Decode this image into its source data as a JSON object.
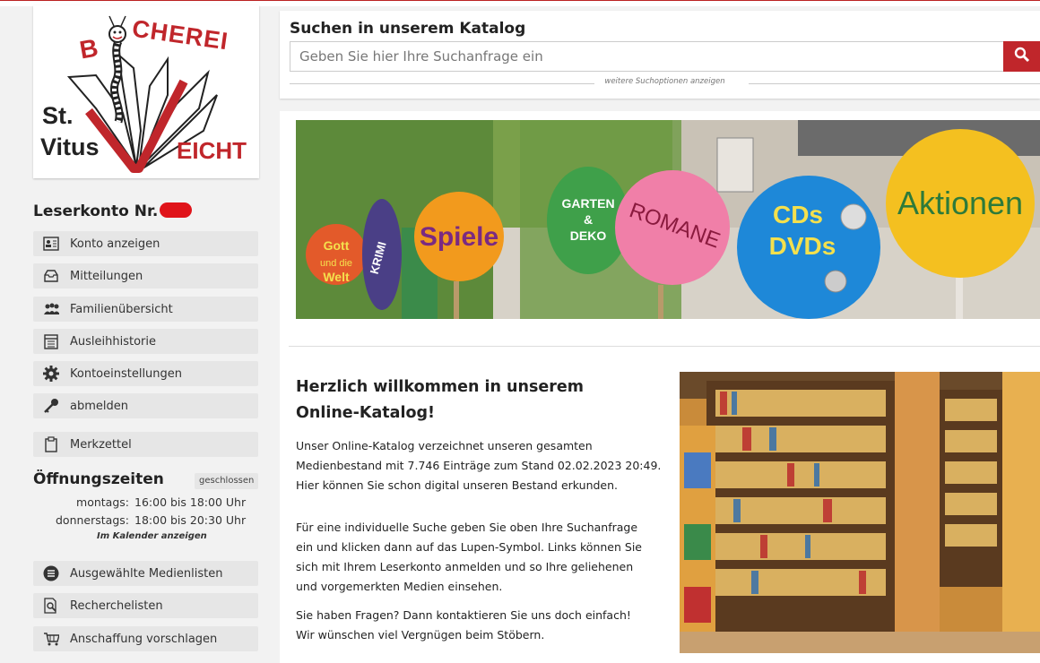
{
  "logo": {
    "text_top": "CHEREI",
    "text_b": "B",
    "text_st": "St.",
    "text_vitus": "Vitus",
    "text_eicht": "EICHT"
  },
  "account": {
    "title": "Leserkonto Nr.",
    "menu": [
      {
        "label": "Konto anzeigen",
        "icon": "id-card-icon"
      },
      {
        "label": "Mitteilungen",
        "icon": "inbox-icon"
      },
      {
        "label": "Familienübersicht",
        "icon": "family-icon"
      },
      {
        "label": "Ausleihhistorie",
        "icon": "calendar-list-icon"
      },
      {
        "label": "Kontoeinstellungen",
        "icon": "gear-icon"
      },
      {
        "label": "abmelden",
        "icon": "key-icon"
      }
    ],
    "notepad": {
      "label": "Merkzettel",
      "icon": "clipboard-icon"
    }
  },
  "hours": {
    "title": "Öffnungszeiten",
    "status": "geschlossen",
    "rows": [
      {
        "day": "montags:",
        "time": "16:00 bis 18:00 Uhr"
      },
      {
        "day": "donnerstags:",
        "time": "18:00 bis 20:30 Uhr"
      }
    ],
    "calendar_link": "Im Kalender anzeigen"
  },
  "lists": [
    {
      "label": "Ausgewählte Medienlisten",
      "icon": "list-circle-icon"
    },
    {
      "label": "Recherchelisten",
      "icon": "search-document-icon"
    },
    {
      "label": "Anschaffung vorschlagen",
      "icon": "cart-icon"
    }
  ],
  "search": {
    "title": "Suchen in unserem Katalog",
    "placeholder": "Geben Sie hier Ihre Suchanfrage ein",
    "more_options": "weitere Suchoptionen anzeigen"
  },
  "banner": {
    "signs": [
      "Gott und die Welt",
      "KRIMI",
      "Spiele",
      "GARTEN & DEKO",
      "ROMANE",
      "CDs",
      "DVDs",
      "Aktionen"
    ]
  },
  "welcome": {
    "heading": "Herzlich willkommen in unserem Online-Katalog!",
    "p1": "Unser Online-Katalog verzeichnet unseren gesamten Medienbestand mit 7.746 Einträge zum Stand 02.02.2023 20:49. Hier können Sie schon digital unseren Bestand erkunden.",
    "p2": "Für eine individuelle Suche geben Sie oben Ihre Suchanfrage ein und klicken dann auf das Lupen-Symbol. Links können Sie sich mit Ihrem Leserkonto anmelden und so Ihre geliehenen und vorgemerkten Medien einsehen.",
    "p3_line1": "Sie haben Fragen? Dann kontaktieren Sie uns doch einfach!",
    "p3_line2": "Wir wünschen viel Vergnügen beim Stöbern."
  },
  "colors": {
    "accent_red": "#c0262b",
    "sidebar_button": "#e6e6e6"
  }
}
